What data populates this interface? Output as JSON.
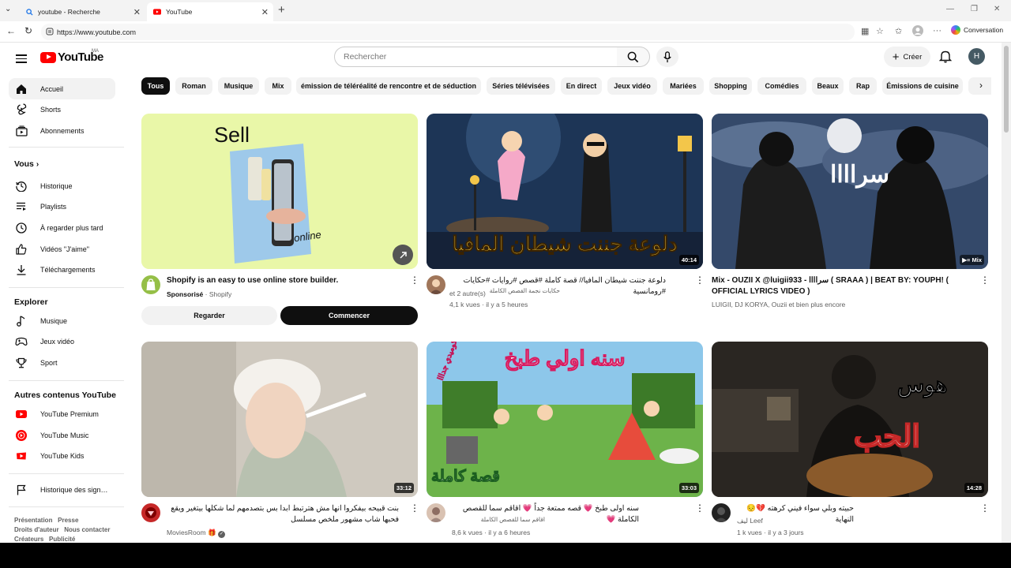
{
  "browser": {
    "tabs": [
      {
        "label": "youtube - Recherche"
      },
      {
        "label": "YouTube"
      }
    ],
    "url": "https://www.youtube.com",
    "conversation_label": "Conversation"
  },
  "header": {
    "logo_text": "YouTube",
    "country_code": "MA",
    "search_placeholder": "Rechercher",
    "create_label": "Créer",
    "avatar_letter": "H"
  },
  "sidebar": {
    "main": [
      {
        "label": "Accueil"
      },
      {
        "label": "Shorts"
      },
      {
        "label": "Abonnements"
      }
    ],
    "you_heading": "Vous",
    "you_items": [
      {
        "label": "Historique"
      },
      {
        "label": "Playlists"
      },
      {
        "label": "À regarder plus tard"
      },
      {
        "label": "Vidéos \"J'aime\""
      },
      {
        "label": "Téléchargements"
      }
    ],
    "explore_heading": "Explorer",
    "explore_items": [
      {
        "label": "Musique"
      },
      {
        "label": "Jeux vidéo"
      },
      {
        "label": "Sport"
      }
    ],
    "more_heading": "Autres contenus YouTube",
    "more_items": [
      {
        "label": "YouTube Premium"
      },
      {
        "label": "YouTube Music"
      },
      {
        "label": "YouTube Kids"
      }
    ],
    "report_history": "Historique des sign…",
    "footer": {
      "line1a": "Présentation",
      "line1b": "Presse",
      "line2a": "Droits d'auteur",
      "line2b": "Nous contacter",
      "line3a": "Créateurs",
      "line3b": "Publicité"
    }
  },
  "chips": [
    "Tous",
    "Roman",
    "Musique",
    "Mix",
    "émission de téléréalité de rencontre et de séduction",
    "Séries télévisées",
    "En direct",
    "Jeux vidéo",
    "Mariées",
    "Shopping",
    "Comédies",
    "Beaux",
    "Rap",
    "Émissions de cuisine"
  ],
  "ad": {
    "thumb_text": "Sell",
    "thumb_text2": "online",
    "title": "Shopify is an easy to use online store builder.",
    "sponsored": "Sponsorisé",
    "sep": " · ",
    "advertiser": "Shopify",
    "watch_label": "Regarder",
    "start_label": "Commencer"
  },
  "videos": [
    {
      "thumb_text": "دلوعة جننت شيطان المافيا",
      "duration": "40:14",
      "title": "دلوعة جننت شيطان المافيا// قصة كاملة #قصص #روايات #حكايات #رومانسية",
      "channel": "حكايات نجمة القصص الكاملة",
      "channel_extra": "et 2 autre(s)",
      "stats": "4,1 k vues · il y a 5 heures"
    },
    {
      "thumb_text": "سراااا",
      "duration_label": "Mix",
      "title": "Mix - OUZII X @luigii933 - سراااا ( SRAAA ) | BEAT BY: YOUPH! ( OFFICIAL LYRICS VIDEO )",
      "channel": "LUIGII, DJ KORYA, Ouzii et bien plus encore",
      "stats": ""
    },
    {
      "duration": "33:12",
      "title": "بنت قبيحه بيفكروا انها مش هترتبط ابدا بس بتصدمهم لما شكلها بيتغير ويقع فحبها شاب مشهور ملخص مسلسل",
      "channel": "MoviesRoom",
      "stats": ""
    },
    {
      "thumb_text": "سنه اولي طبخ",
      "thumb_text2": "قصة كاملة",
      "thumb_text3": "كوميدي جدااا",
      "duration": "33:03",
      "title": "سنه اولى طبخ 💗 قصه ممتعة جداً 💗 اقاقم سما للقصص الكاملة 💗",
      "channel": "اقاقم سما للقصص الكاملة",
      "stats": "8,6 k vues · il y a 6 heures"
    },
    {
      "thumb_text": "هوس",
      "thumb_text2": "الحب",
      "duration": "14:28",
      "title": "حبيته وبلي سواء فيني كرهته 💔😔 النهاية",
      "channel": "ليف Leef",
      "stats": "1 k vues · il y a 3 jours"
    }
  ]
}
